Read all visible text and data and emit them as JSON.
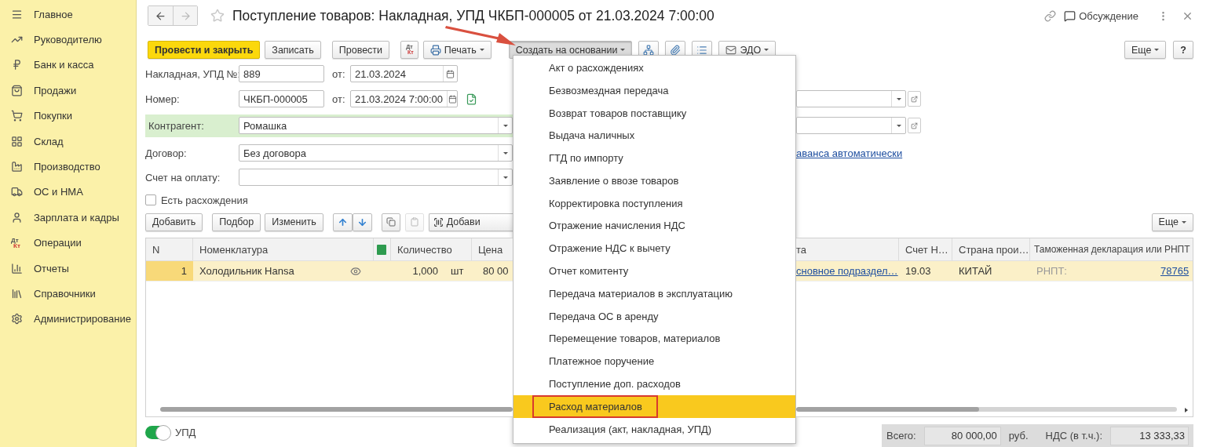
{
  "sidebar": {
    "items": [
      {
        "label": "Главное",
        "kind": "icon"
      },
      {
        "label": "Руководителю",
        "kind": "icon"
      },
      {
        "label": "Банк и касса",
        "kind": "icon"
      },
      {
        "label": "Продажи",
        "kind": "icon"
      },
      {
        "label": "Покупки",
        "kind": "icon"
      },
      {
        "label": "Склад",
        "kind": "icon"
      },
      {
        "label": "Производство",
        "kind": "icon"
      },
      {
        "label": "ОС и НМА",
        "kind": "icon"
      },
      {
        "label": "Зарплата и кадры",
        "kind": "icon"
      },
      {
        "label": "Операции",
        "kind": "dtkt",
        "dt": "Дт",
        "kt": "Кт"
      },
      {
        "label": "Отчеты",
        "kind": "icon"
      },
      {
        "label": "Справочники",
        "kind": "icon"
      },
      {
        "label": "Администрирование",
        "kind": "icon"
      }
    ]
  },
  "header": {
    "title": "Поступление товаров: Накладная, УПД ЧКБП-000005 от 21.03.2024 7:00:00",
    "discussion": "Обсуждение"
  },
  "toolbar": {
    "buttons": [
      {
        "kind": "primary",
        "label": "Провести и закрыть",
        "pressed": false
      },
      {
        "kind": "plain",
        "label": "Записать",
        "pressed": false
      },
      {
        "kind": "plain",
        "label": "Провести",
        "pressed": false
      },
      {
        "kind": "dtkt",
        "dt": "Дт",
        "kt": "Кт",
        "pressed": false
      },
      {
        "kind": "menu",
        "label": "Печать",
        "pressed": false
      },
      {
        "kind": "menu",
        "label": "Создать на основании",
        "pressed": true
      },
      {
        "kind": "icon",
        "pressed": false
      },
      {
        "kind": "icon",
        "pressed": false
      },
      {
        "kind": "icon",
        "pressed": false
      },
      {
        "kind": "menu",
        "label": "ЭДО",
        "pressed": false
      }
    ],
    "more": "Еще",
    "help": "?"
  },
  "form": {
    "invoice": {
      "label": "Накладная, УПД №:",
      "value": "889",
      "date_label": "от:",
      "date": "21.03.2024"
    },
    "number": {
      "label": "Номер:",
      "value": "ЧКБП-000005",
      "date_label": "от:",
      "date": "21.03.2024  7:00:00"
    },
    "counterparty": {
      "label": "Контрагент:",
      "value": "Ромашка"
    },
    "contract": {
      "label": "Договор:",
      "value": "Без договора"
    },
    "payment_invoice": {
      "label": "Счет на оплату:"
    },
    "discrepancies": {
      "label": "Есть расхождения",
      "checked": false
    },
    "advance_link": "аванса автоматически"
  },
  "table_toolbar": {
    "buttons": [
      "Добавить",
      "Подбор",
      "Изменить"
    ],
    "icon_buttons": [
      {
        "disabled": false
      },
      {
        "disabled": true
      }
    ],
    "barcode_button": "Добави",
    "more": "Еще"
  },
  "table": {
    "columns_left": [
      "N",
      "Номенклатура",
      "Количество",
      "Цена"
    ],
    "columns_right": [
      "та",
      "Счет Н…",
      "Страна прои…",
      "Таможенная декларация или РНПТ"
    ],
    "rows": [
      {
        "selected": true,
        "n": "1",
        "name": "Холодильник Hansa",
        "qty": "1,000",
        "unit": "шт",
        "price": "80 00",
        "division": "сновное подраздел…",
        "account": "19.03",
        "country": "КИТАЙ",
        "rnpt_label": "РНПТ:",
        "rnpt": "78765"
      }
    ]
  },
  "footer": {
    "toggle": {
      "label": "УПД",
      "on": true
    },
    "totals": {
      "total_label": "Всего:",
      "total": "80 000,00",
      "currency": "руб.",
      "vat_label": "НДС (в т.ч.):",
      "vat": "13 333,33"
    }
  },
  "menu": {
    "items": [
      {
        "label": "Акт о расхождениях",
        "selected": false,
        "annotated": false
      },
      {
        "label": "Безвозмездная передача",
        "selected": false,
        "annotated": false
      },
      {
        "label": "Возврат товаров поставщику",
        "selected": false,
        "annotated": false
      },
      {
        "label": "Выдача наличных",
        "selected": false,
        "annotated": false
      },
      {
        "label": "ГТД по импорту",
        "selected": false,
        "annotated": false
      },
      {
        "label": "Заявление о ввозе товаров",
        "selected": false,
        "annotated": false
      },
      {
        "label": "Корректировка поступления",
        "selected": false,
        "annotated": false
      },
      {
        "label": "Отражение начисления НДС",
        "selected": false,
        "annotated": false
      },
      {
        "label": "Отражение НДС к вычету",
        "selected": false,
        "annotated": false
      },
      {
        "label": "Отчет комитенту",
        "selected": false,
        "annotated": false
      },
      {
        "label": "Передача материалов в эксплуатацию",
        "selected": false,
        "annotated": false
      },
      {
        "label": "Передача ОС в аренду",
        "selected": false,
        "annotated": false
      },
      {
        "label": "Перемещение товаров, материалов",
        "selected": false,
        "annotated": false
      },
      {
        "label": "Платежное поручение",
        "selected": false,
        "annotated": false
      },
      {
        "label": "Поступление доп. расходов",
        "selected": false,
        "annotated": false
      },
      {
        "label": "Расход материалов",
        "selected": true,
        "annotated": true
      },
      {
        "label": "Реализация (акт, накладная, УПД)",
        "selected": false,
        "annotated": false
      }
    ]
  }
}
